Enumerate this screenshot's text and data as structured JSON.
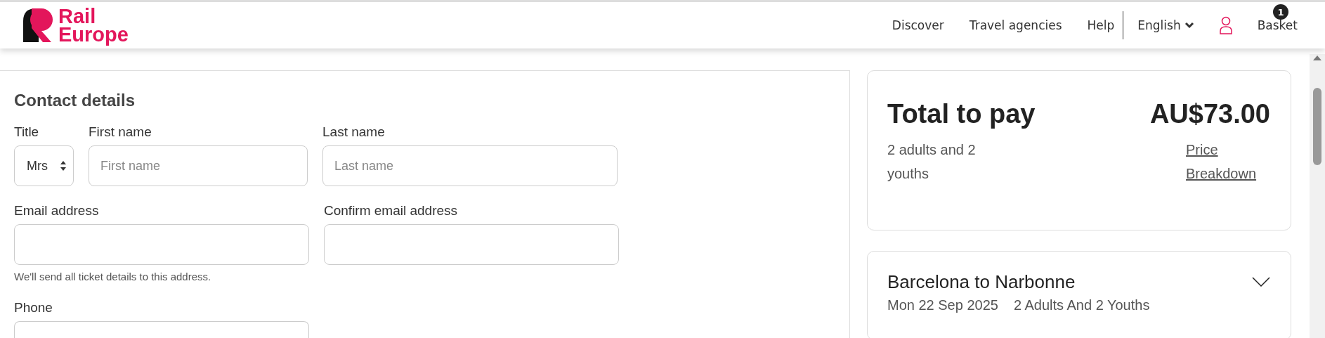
{
  "header": {
    "logo": {
      "line_1": "Rail",
      "line_2": "Europe"
    },
    "nav": [
      {
        "label": "Discover"
      },
      {
        "label": "Travel agencies"
      },
      {
        "label": "Help"
      }
    ],
    "language": "English",
    "basket": {
      "label": "Basket",
      "count": "1"
    }
  },
  "contact": {
    "heading": "Contact details",
    "title": {
      "label": "Title",
      "value": "Mrs"
    },
    "first_name": {
      "label": "First name",
      "placeholder": "First name"
    },
    "last_name": {
      "label": "Last name",
      "placeholder": "Last name"
    },
    "email": {
      "label": "Email address",
      "hint": "We'll send all ticket details to this address."
    },
    "confirm_email": {
      "label": "Confirm email address"
    },
    "phone": {
      "label": "Phone"
    }
  },
  "summary": {
    "title": "Total to pay",
    "amount": "AU$73.00",
    "travellers": "2 adults and 2 youths",
    "link": "Price Breakdown"
  },
  "journey": {
    "title": "Barcelona to Narbonne",
    "date": "Mon 22 Sep 2025",
    "passengers": "2 Adults And 2 Youths",
    "expanded": false
  }
}
